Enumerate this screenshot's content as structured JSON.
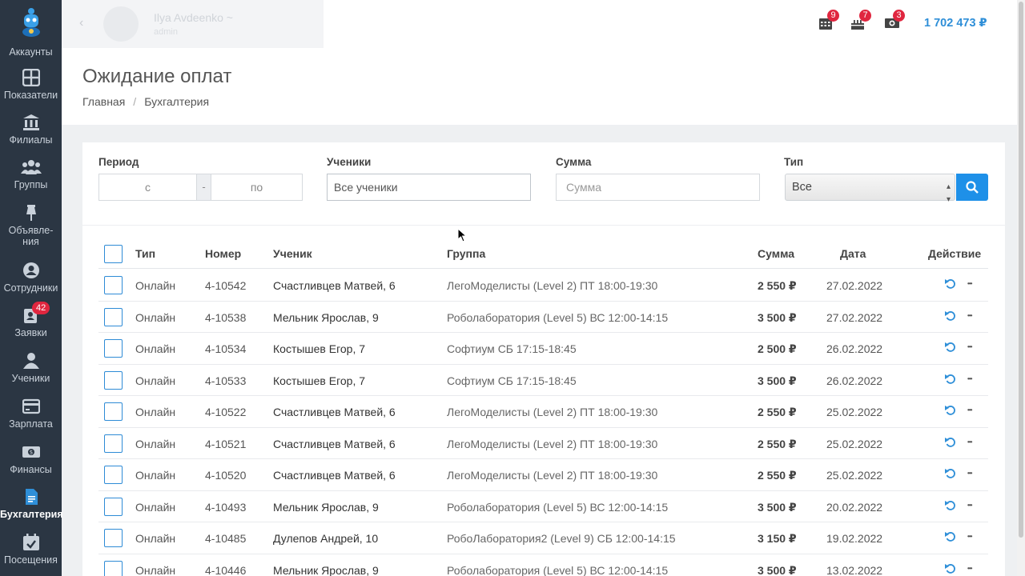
{
  "sidebar": {
    "items": [
      {
        "label": "Аккаунты",
        "icon": "robot-logo-icon"
      },
      {
        "label": "Показатели",
        "icon": "dashboard-grid-icon"
      },
      {
        "label": "Филиалы",
        "icon": "bank-icon"
      },
      {
        "label": "Группы",
        "icon": "users-group-icon"
      },
      {
        "label": "Объявле-",
        "label2": "ния",
        "icon": "pin-icon"
      },
      {
        "label": "Сотрудники",
        "icon": "user-circle-icon"
      },
      {
        "label": "Заявки",
        "icon": "requests-icon",
        "badge": "42"
      },
      {
        "label": "Ученики",
        "icon": "user-icon"
      },
      {
        "label": "Зарплата",
        "icon": "credit-card-icon"
      },
      {
        "label": "Финансы",
        "icon": "money-icon"
      },
      {
        "label": "Бухгалтерия",
        "icon": "document-icon",
        "active": true
      },
      {
        "label": "Посещения",
        "icon": "calendar-check-icon"
      }
    ]
  },
  "topbar": {
    "user_name": "Ilya Avdeenko ~",
    "user_role": "admin",
    "badges": {
      "calendar": "9",
      "cake": "7",
      "money": "3"
    },
    "balance": "1 702 473 ₽"
  },
  "page": {
    "title": "Ожидание оплат",
    "breadcrumb": [
      "Главная",
      "Бухгалтерия"
    ]
  },
  "filters": {
    "period_label": "Период",
    "period_from_placeholder": "с",
    "period_sep": "-",
    "period_to_placeholder": "по",
    "students_label": "Ученики",
    "students_value": "Все ученики",
    "sum_label": "Сумма",
    "sum_placeholder": "Сумма",
    "type_label": "Тип",
    "type_value": "Все"
  },
  "table": {
    "headers": {
      "type": "Тип",
      "number": "Номер",
      "student": "Ученик",
      "group": "Группа",
      "sum": "Сумма",
      "date": "Дата",
      "action": "Действие"
    },
    "rows": [
      {
        "type": "Онлайн",
        "number": "4-10542",
        "student": "Счастливцев Матвей, 6",
        "group": "ЛегоМоделисты (Level 2) ПТ 18:00-19:30",
        "sum": "2 550 ₽",
        "date": "27.02.2022"
      },
      {
        "type": "Онлайн",
        "number": "4-10538",
        "student": "Мельник Ярослав, 9",
        "group": "Роболаборатория (Level 5) ВС 12:00-14:15",
        "sum": "3 500 ₽",
        "date": "27.02.2022"
      },
      {
        "type": "Онлайн",
        "number": "4-10534",
        "student": "Костышев Егор, 7",
        "group": "Софтиум СБ 17:15-18:45",
        "sum": "2 500 ₽",
        "date": "26.02.2022"
      },
      {
        "type": "Онлайн",
        "number": "4-10533",
        "student": "Костышев Егор, 7",
        "group": "Софтиум СБ 17:15-18:45",
        "sum": "3 500 ₽",
        "date": "26.02.2022"
      },
      {
        "type": "Онлайн",
        "number": "4-10522",
        "student": "Счастливцев Матвей, 6",
        "group": "ЛегоМоделисты (Level 2) ПТ 18:00-19:30",
        "sum": "2 550 ₽",
        "date": "25.02.2022"
      },
      {
        "type": "Онлайн",
        "number": "4-10521",
        "student": "Счастливцев Матвей, 6",
        "group": "ЛегоМоделисты (Level 2) ПТ 18:00-19:30",
        "sum": "2 550 ₽",
        "date": "25.02.2022"
      },
      {
        "type": "Онлайн",
        "number": "4-10520",
        "student": "Счастливцев Матвей, 6",
        "group": "ЛегоМоделисты (Level 2) ПТ 18:00-19:30",
        "sum": "2 550 ₽",
        "date": "25.02.2022"
      },
      {
        "type": "Онлайн",
        "number": "4-10493",
        "student": "Мельник Ярослав, 9",
        "group": "Роболаборатория (Level 5) ВС 12:00-14:15",
        "sum": "3 500 ₽",
        "date": "20.02.2022"
      },
      {
        "type": "Онлайн",
        "number": "4-10485",
        "student": "Дулепов Андрей, 10",
        "group": "РобоЛаборатория2 (Level 9) СБ 12:00-14:15",
        "sum": "3 150 ₽",
        "date": "19.02.2022"
      },
      {
        "type": "Онлайн",
        "number": "4-10446",
        "student": "Мельник Ярослав, 9",
        "group": "Роболаборатория (Level 5) ВС 12:00-14:15",
        "sum": "3 500 ₽",
        "date": "13.02.2022"
      }
    ]
  },
  "colors": {
    "sidebar": "#2b3643",
    "accent": "#1e90e8",
    "badge": "#e0263f",
    "balance": "#2f8fd8"
  }
}
